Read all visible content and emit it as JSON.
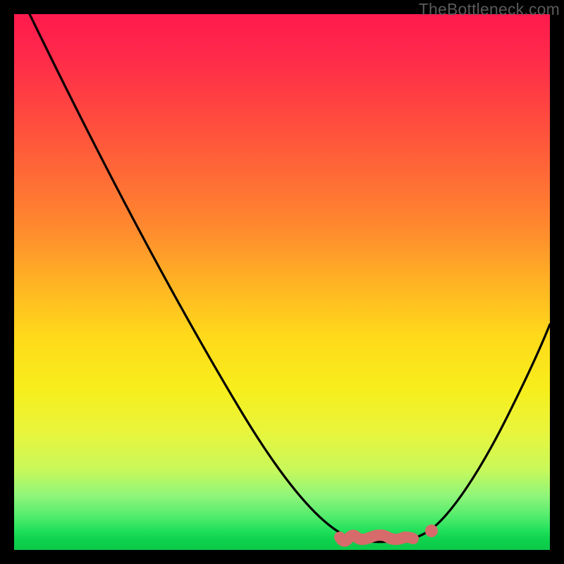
{
  "watermark": "TheBottleneck.com",
  "chart_data": {
    "type": "line",
    "title": "",
    "xlabel": "",
    "ylabel": "",
    "xlim": [
      0,
      100
    ],
    "ylim": [
      0,
      100
    ],
    "grid": false,
    "legend": false,
    "series": [
      {
        "name": "bottleneck-curve",
        "x": [
          3,
          10,
          20,
          30,
          40,
          50,
          58,
          62,
          66,
          70,
          74,
          78,
          80,
          84,
          90,
          95,
          100
        ],
        "y": [
          100,
          86,
          70,
          54,
          38,
          22,
          10,
          5,
          2,
          1,
          1,
          2,
          3,
          7,
          17,
          28,
          41
        ]
      }
    ],
    "markers": [
      {
        "name": "valley-dot-right",
        "x": 78,
        "y": 2.5,
        "color": "#d76a6a",
        "r": 1.2
      },
      {
        "name": "valley-squiggle-left",
        "path_x": [
          61,
          63,
          65,
          67,
          70,
          73,
          75
        ],
        "path_y": [
          1.6,
          2.4,
          1.5,
          1.5,
          1.5,
          1.5,
          1.6
        ],
        "color": "#d76a6a",
        "stroke_w": 2.2
      }
    ],
    "colors": {
      "curve": "#000000",
      "background_top": "#ff1a4d",
      "background_mid": "#ffd91a",
      "background_bottom": "#0aca48",
      "marker": "#d76a6a"
    }
  }
}
